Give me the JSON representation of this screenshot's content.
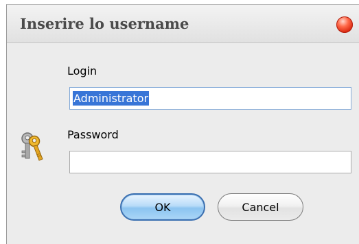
{
  "dialog": {
    "title": "Inserire lo username"
  },
  "form": {
    "login_label": "Login",
    "login_value": "Administrator",
    "password_label": "Password",
    "password_value": ""
  },
  "buttons": {
    "ok_label": "OK",
    "cancel_label": "Cancel"
  },
  "icons": {
    "close": "close-icon",
    "keys": "keys-icon"
  },
  "colors": {
    "close_red": "#d8240c",
    "ok_border": "#3a6fb0",
    "selection": "#3875d7"
  }
}
